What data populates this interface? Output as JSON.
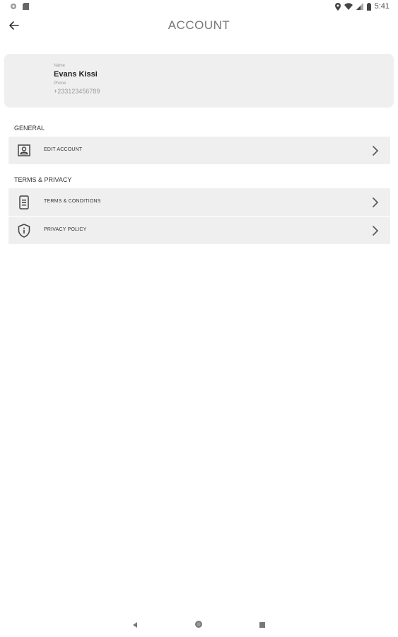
{
  "status_bar": {
    "time": "5:41",
    "left_icons": [
      "settings-icon",
      "sd-card-icon"
    ],
    "right_icons": [
      "location-icon",
      "wifi-icon",
      "signal-icon",
      "battery-icon"
    ]
  },
  "app_bar": {
    "title": "ACCOUNT",
    "back_icon": "arrow-back-icon"
  },
  "profile": {
    "name_label": "Name",
    "name": "Evans Kissi",
    "phone_label": "Phone",
    "phone": "+233123456789"
  },
  "sections": {
    "general": {
      "header": "GENERAL",
      "items": [
        {
          "label": "EDIT ACCOUNT",
          "icon": "account-box-icon"
        }
      ]
    },
    "terms_privacy": {
      "header": "TERMS & PRIVACY",
      "items": [
        {
          "label": "TERMS & CONDITIONS",
          "icon": "document-icon"
        },
        {
          "label": "PRIVACY POLICY",
          "icon": "shield-info-icon"
        }
      ]
    }
  },
  "nav_bar": {
    "buttons": [
      "nav-back-icon",
      "nav-home-icon",
      "nav-recents-icon"
    ]
  },
  "colors": {
    "card_background": "#efefef",
    "title_text": "#777777",
    "muted_text": "#9a9a9a"
  }
}
